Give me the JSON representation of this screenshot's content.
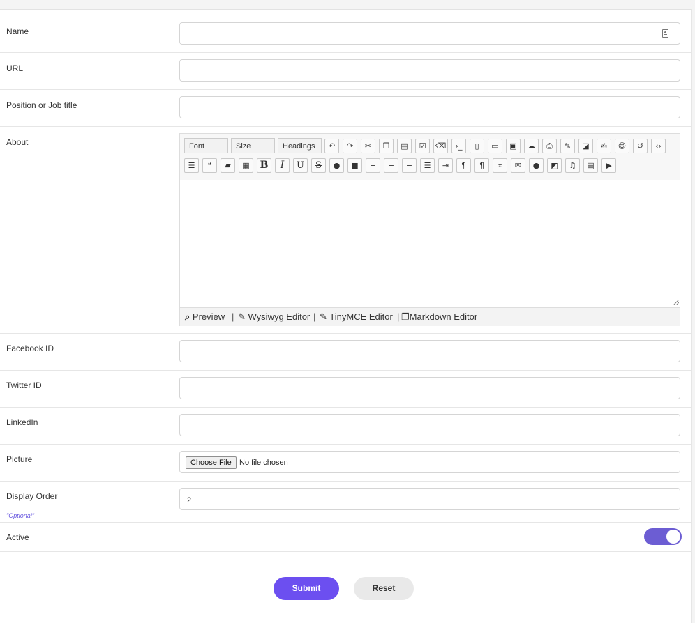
{
  "form": {
    "name_label": "Name",
    "name_value": "",
    "url_label": "URL",
    "url_value": "",
    "position_label": "Position or Job title",
    "position_value": "",
    "about_label": "About",
    "facebook_label": "Facebook ID",
    "facebook_value": "",
    "twitter_label": "Twitter ID",
    "twitter_value": "",
    "linkedin_label": "LinkedIn",
    "linkedin_value": "",
    "picture_label": "Picture",
    "choose_file_label": "Choose File",
    "file_status": "No file chosen",
    "display_order_label": "Display Order",
    "display_order_value": "2",
    "optional_note": "\"Optional\"",
    "active_label": "Active",
    "active_on": true
  },
  "editor": {
    "font_label": "Font",
    "size_label": "Size",
    "headings_label": "Headings",
    "toolbar_row1_icons": [
      "undo-icon",
      "redo-icon",
      "cut-icon",
      "copy-icon",
      "paste-icon",
      "select-all-icon",
      "eraser-icon",
      "terminal-icon",
      "document-icon",
      "rectangle-icon",
      "image-icon",
      "upload-icon",
      "print-icon",
      "pencil-icon",
      "edit-icon",
      "edit-box-icon",
      "smile-icon",
      "history-icon",
      "code-icon"
    ],
    "toolbar_row2_icons": [
      "list-icon",
      "quote-icon",
      "folder-icon",
      "qrcode-icon",
      "bold-icon",
      "italic-icon",
      "underline-icon",
      "strike-icon",
      "palette-icon",
      "fill-icon",
      "align-right-icon",
      "align-center-icon",
      "align-left-icon",
      "justify-icon",
      "indent-icon",
      "paragraph-ltr-icon",
      "paragraph-rtl-icon",
      "link-icon",
      "envelope-icon",
      "comment-icon",
      "external-link-icon",
      "music-icon",
      "film-icon",
      "youtube-icon"
    ],
    "content": "",
    "footer": {
      "preview": "Preview",
      "wysiwyg": "Wysiwyg Editor",
      "tinymce": "TinyMCE Editor",
      "markdown": "Markdown Editor",
      "separator": "|"
    }
  },
  "actions": {
    "submit_label": "Submit",
    "reset_label": "Reset"
  },
  "colors": {
    "accent": "#6c4ff0",
    "toggle": "#6c5dd3",
    "optional_text": "#6a5ae0"
  }
}
